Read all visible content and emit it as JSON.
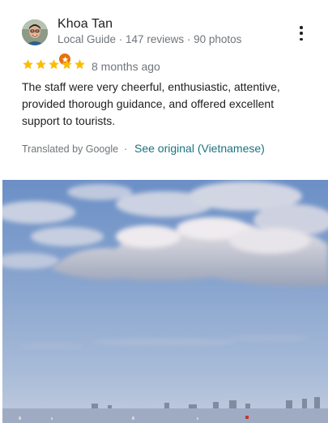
{
  "reviewer": {
    "name": "Khoa Tan",
    "meta": "Local Guide · 147 reviews · 90 photos",
    "avatar_icon": "person-avatar",
    "badge_icon": "local-guide-star-icon"
  },
  "rating": {
    "value": 5,
    "max": 5,
    "color": "#fbbc04"
  },
  "time": "8 months ago",
  "review_text": "The staff were very cheerful, enthusiastic, attentive, provided thorough guidance, and offered excellent support to tourists.",
  "translation": {
    "label": "Translated by Google",
    "separator": "·",
    "link": "See original (Vietnamese)"
  },
  "menu_icon": "more-vertical-icon",
  "photo": {
    "subject": "sky-over-beach-photo"
  }
}
